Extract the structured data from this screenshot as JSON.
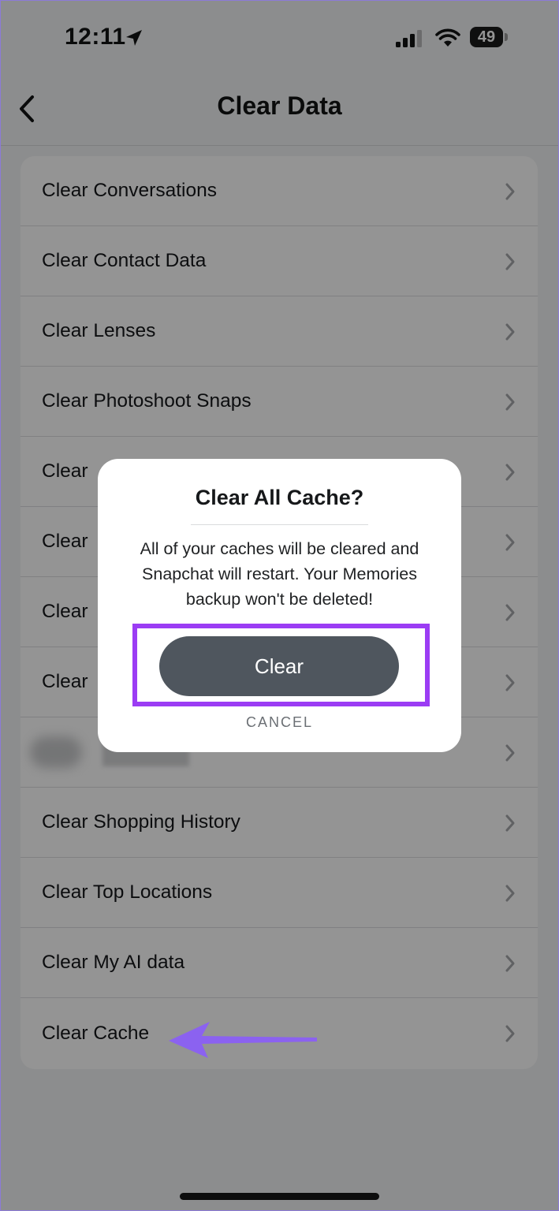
{
  "status_bar": {
    "time": "12:11",
    "battery": "49",
    "icons": [
      "location-arrow-icon",
      "cellular-signal-icon",
      "wifi-icon",
      "battery-icon"
    ]
  },
  "nav": {
    "title": "Clear Data",
    "back_icon": "chevron-left-icon"
  },
  "list": {
    "items": [
      {
        "label": "Clear Conversations"
      },
      {
        "label": "Clear Contact Data"
      },
      {
        "label": "Clear Lenses"
      },
      {
        "label": "Clear Photoshoot Snaps"
      },
      {
        "label": "Clear"
      },
      {
        "label": "Clear"
      },
      {
        "label": "Clear"
      },
      {
        "label": "Clear"
      },
      {
        "label": ""
      },
      {
        "label": "Clear Shopping History"
      },
      {
        "label": "Clear Top Locations"
      },
      {
        "label": "Clear My AI data"
      },
      {
        "label": "Clear Cache"
      }
    ],
    "row_icon": "chevron-right-icon"
  },
  "dialog": {
    "title": "Clear All Cache?",
    "message": "All of your caches will be cleared and Snapchat will restart. Your Memories backup won't be deleted!",
    "confirm_label": "Clear",
    "cancel_label": "CANCEL"
  },
  "colors": {
    "annotation": "#9b3cf4",
    "arrow": "#8b62f0",
    "button": "#4f565e"
  }
}
